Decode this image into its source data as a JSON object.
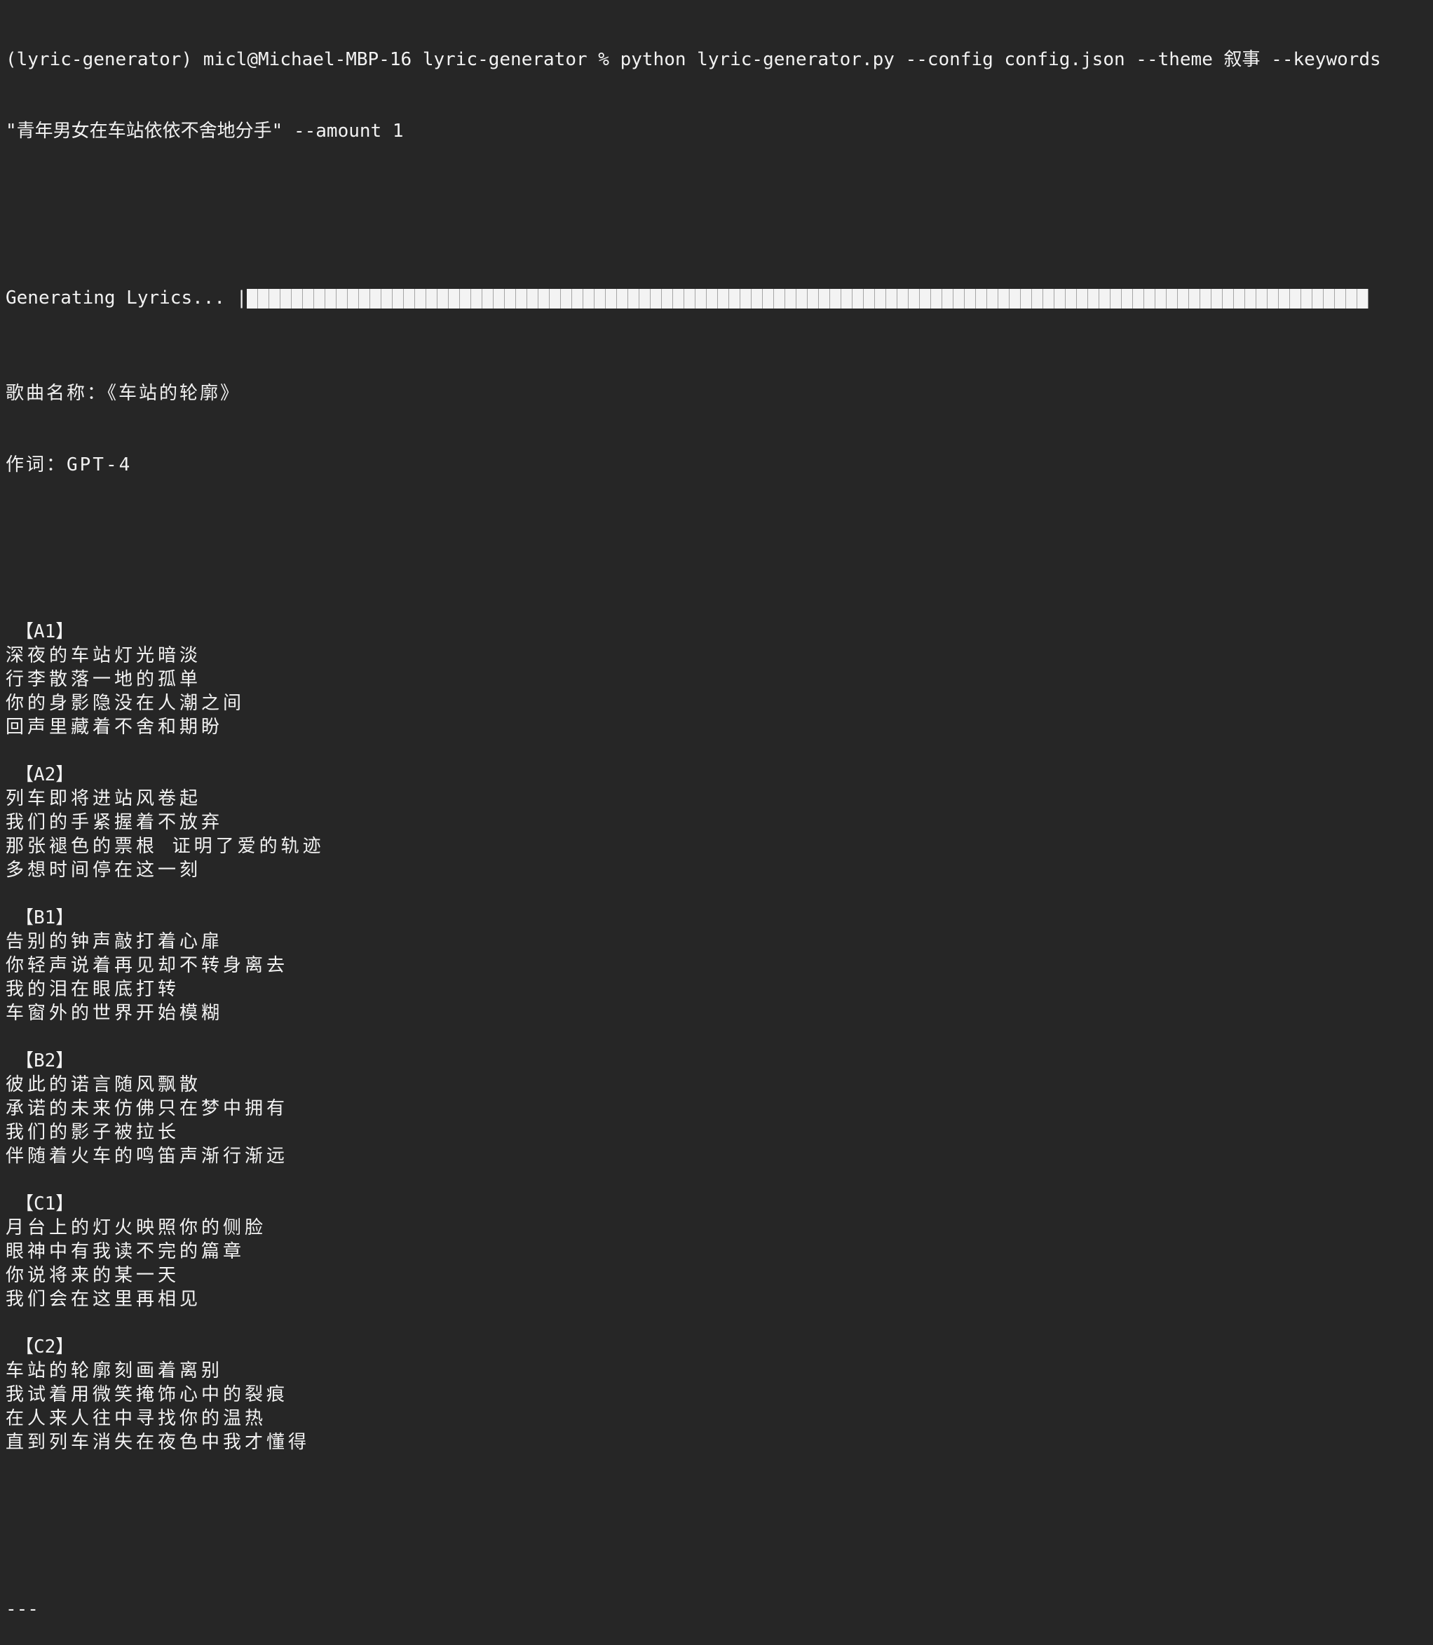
{
  "terminal": {
    "command_line_1": "(lyric-generator) micl@Michael-MBP-16 lyric-generator % python lyric-generator.py --config config.json --theme 叙事 --keywords",
    "command_line_2": "\"青年男女在车站依依不舍地分手\" --amount 1",
    "progress": {
      "label": "Generating Lyrics... |",
      "percent": 100,
      "cells": 100
    },
    "song_title_line": "歌曲名称：《车站的轮廓》",
    "lyricist_line": "作词：GPT-4",
    "sections": [
      {
        "label": "【A1】",
        "lines": [
          "深夜的车站灯光暗淡",
          "行李散落一地的孤单",
          "你的身影隐没在人潮之间",
          "回声里藏着不舍和期盼"
        ]
      },
      {
        "label": "【A2】",
        "lines": [
          "列车即将进站风卷起",
          "我们的手紧握着不放弃",
          "那张褪色的票根 证明了爱的轨迹",
          "多想时间停在这一刻"
        ]
      },
      {
        "label": "【B1】",
        "lines": [
          "告别的钟声敲打着心扉",
          "你轻声说着再见却不转身离去",
          "我的泪在眼底打转",
          "车窗外的世界开始模糊"
        ]
      },
      {
        "label": "【B2】",
        "lines": [
          "彼此的诺言随风飘散",
          "承诺的未来仿佛只在梦中拥有",
          "我们的影子被拉长",
          "伴随着火车的鸣笛声渐行渐远"
        ]
      },
      {
        "label": "【C1】",
        "lines": [
          "月台上的灯火映照你的侧脸",
          "眼神中有我读不完的篇章",
          "你说将来的某一天",
          "我们会在这里再相见"
        ]
      },
      {
        "label": "【C2】",
        "lines": [
          "车站的轮廓刻画着离别",
          "我试着用微笑掩饰心中的裂痕",
          "在人来人往中寻找你的温热",
          "直到列车消失在夜色中我才懂得"
        ]
      }
    ],
    "footer_separator": "---"
  },
  "colors": {
    "background": "#262626",
    "text": "#f2f2f2",
    "progress_fill": "#f3f3f3",
    "progress_divider": "#a5a5a5"
  }
}
